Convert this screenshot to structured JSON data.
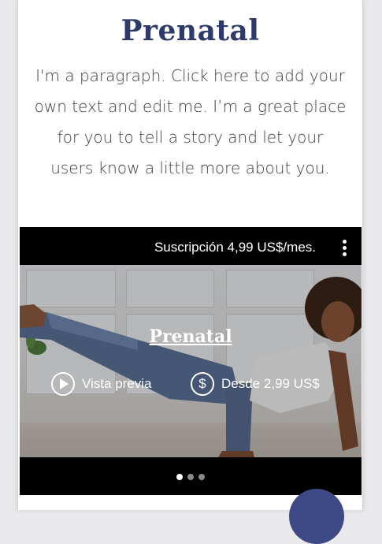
{
  "page": {
    "title": "Prenatal",
    "paragraph": "I'm a paragraph. Click here to add your own text and edit me. I’m a great place for you to tell a story and let your users know a little more about you."
  },
  "player": {
    "subscription_label": "Suscripción 4,99 US$/mes.",
    "more_icon": "vertical-dots-icon",
    "video_title": "Prenatal",
    "preview_label": "Vista previa",
    "preview_icon": "play-icon",
    "price_label": "Desde 2,99 US$",
    "price_icon": "dollar-icon",
    "price_icon_glyph": "$",
    "pagination": {
      "total": 3,
      "active": 1
    }
  },
  "colors": {
    "title": "#2d3a6b",
    "player_background": "#000000",
    "chat_button": "#3e4a86"
  }
}
